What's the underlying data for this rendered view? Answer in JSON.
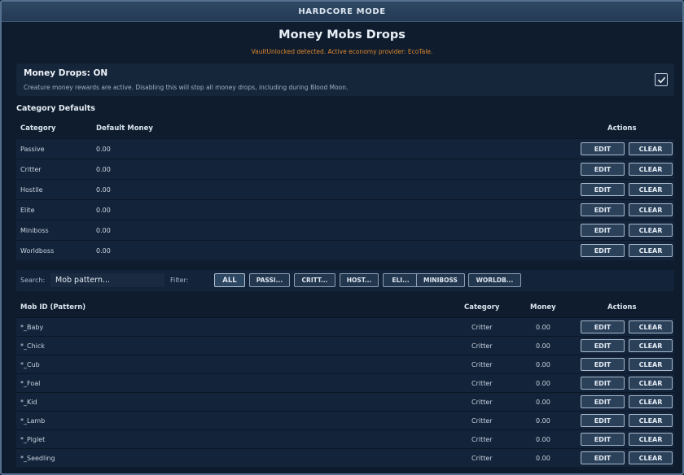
{
  "window": {
    "title": "HARDCORE MODE"
  },
  "page": {
    "title": "Money Mobs Drops",
    "notice": "VaultUnlocked detected. Active economy provider: EcoTale."
  },
  "money_drops": {
    "title": "Money Drops: ON",
    "description": "Creature money rewards are active. Disabling this will stop all money drops, including during Blood Moon.",
    "checked": true,
    "icon": "check-icon"
  },
  "category_defaults": {
    "title": "Category Defaults",
    "headers": {
      "category": "Category",
      "default_money": "Default Money",
      "actions": "Actions"
    },
    "rows": [
      {
        "category": "Passive",
        "money": "0.00"
      },
      {
        "category": "Critter",
        "money": "0.00"
      },
      {
        "category": "Hostile",
        "money": "0.00"
      },
      {
        "category": "Elite",
        "money": "0.00"
      },
      {
        "category": "Miniboss",
        "money": "0.00"
      },
      {
        "category": "Worldboss",
        "money": "0.00"
      }
    ]
  },
  "buttons": {
    "edit": "EDIT",
    "clear": "CLEAR"
  },
  "filter_bar": {
    "search_label": "Search:",
    "search_placeholder": "Mob pattern...",
    "filter_label": "Filter:",
    "chips": [
      "ALL",
      "PASSI...",
      "CRITT...",
      "HOST...",
      "ELI...",
      "MINIBOSS",
      "WORLDB..."
    ],
    "active_chip": "ALL"
  },
  "mobs": {
    "headers": {
      "mob_id": "Mob ID (Pattern)",
      "category": "Category",
      "money": "Money",
      "actions": "Actions"
    },
    "rows": [
      {
        "pattern": "*_Baby",
        "category": "Critter",
        "money": "0.00"
      },
      {
        "pattern": "*_Chick",
        "category": "Critter",
        "money": "0.00"
      },
      {
        "pattern": "*_Cub",
        "category": "Critter",
        "money": "0.00"
      },
      {
        "pattern": "*_Foal",
        "category": "Critter",
        "money": "0.00"
      },
      {
        "pattern": "*_Kid",
        "category": "Critter",
        "money": "0.00"
      },
      {
        "pattern": "*_Lamb",
        "category": "Critter",
        "money": "0.00"
      },
      {
        "pattern": "*_Piglet",
        "category": "Critter",
        "money": "0.00"
      },
      {
        "pattern": "*_Seedling",
        "category": "Critter",
        "money": "0.00"
      }
    ]
  }
}
